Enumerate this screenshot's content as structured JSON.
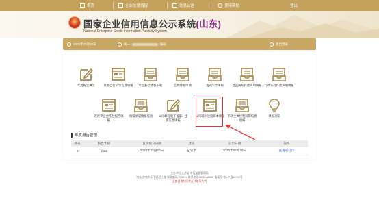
{
  "nav": {
    "items": [
      {
        "label": "首页",
        "icon": "home-icon"
      },
      {
        "label": "企业信息填报",
        "icon": "form-icon"
      },
      {
        "label": "信息公告",
        "icon": "announcement-icon"
      },
      {
        "label": "使用帮助",
        "icon": "help-icon"
      },
      {
        "label": "登出",
        "icon": ""
      }
    ]
  },
  "header": {
    "title_main": "国家企业信用信息公示系统",
    "title_province": "(山东)",
    "subtitle": "National Enterprise Credit Information Publicity System"
  },
  "infobar": {
    "item1": "2025年02月20日",
    "item2_prefix": "统一",
    "item2_suffix": "编号",
    "item3": "退出登录"
  },
  "tiles": [
    {
      "label": "年度报告填写",
      "icon": "edit-icon"
    },
    {
      "label": "其他自行公示信息填报",
      "icon": "monitor-icon"
    },
    {
      "label": "年度报告模板下载",
      "icon": "inbox-icon"
    },
    {
      "label": "信用修复申请",
      "icon": "inbox-icon"
    },
    {
      "label": "注销公示填报",
      "icon": "inbox-icon"
    },
    {
      "label": "营业执照作废声明填报",
      "icon": "inbox-icon"
    },
    {
      "label": "行政许可作废声明填报",
      "icon": "inbox-icon"
    },
    {
      "label": "农民专业合作社报告填报",
      "icon": "monitor-icon"
    },
    {
      "label": "填报承诺填报信息",
      "icon": "inbox-icon"
    },
    {
      "label": "公司章程电子备案、出资信息填报",
      "icon": "edit-icon"
    },
    {
      "label": "公司减少注册资本填报",
      "icon": "monitor-icon"
    },
    {
      "label": "市场主体经营异常信息填报",
      "icon": "inbox-icon"
    },
    {
      "label": "填报须知",
      "icon": "lightbulb-icon"
    }
  ],
  "section": {
    "title": "年度报告管理"
  },
  "table": {
    "headers": [
      "序号",
      "报告年份",
      "首次提交日期",
      "状态",
      "公示日期",
      "操作"
    ],
    "rows": [
      [
        "1",
        "2022",
        "2023年02月20日",
        "已公示",
        "2023年02月20日",
        "查看或打印"
      ]
    ]
  },
  "footer": {
    "line1": "主办单位:山东省市场监督管理局",
    "line2": "地址:济南市历下区经十路 邮政编码:250014 联系电话:0531-88688 备案号:鲁ICP备11000号",
    "line3": "业务咨询与技术支持联系方式"
  },
  "colors": {
    "brand_gold": "#c4a25e",
    "highlight_red": "#e5393b",
    "icon_gold": "#a88a4c"
  }
}
